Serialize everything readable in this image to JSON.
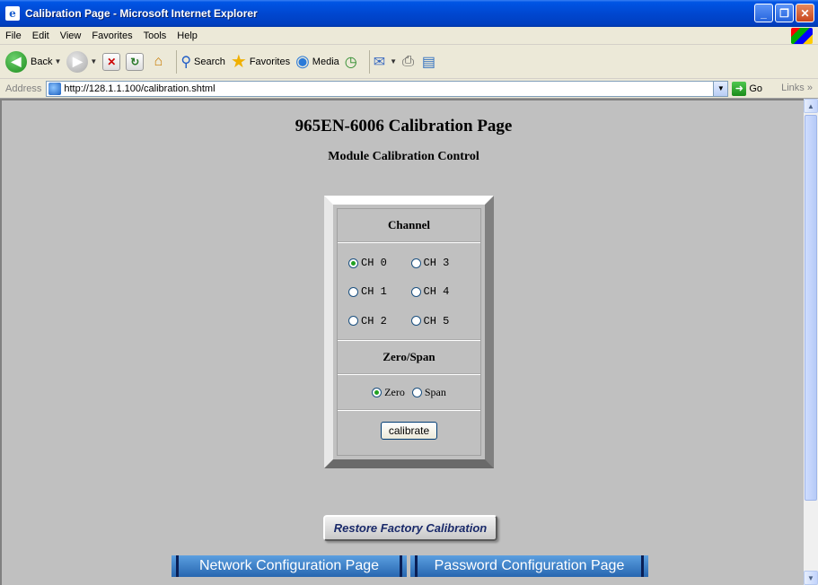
{
  "window": {
    "title": "Calibration Page - Microsoft Internet Explorer"
  },
  "menu": [
    "File",
    "Edit",
    "View",
    "Favorites",
    "Tools",
    "Help"
  ],
  "toolbar": {
    "back": "Back",
    "search": "Search",
    "favorites": "Favorites",
    "media": "Media"
  },
  "address": {
    "label": "Address",
    "url": "http://128.1.1.100/calibration.shtml",
    "go": "Go",
    "links": "Links"
  },
  "page": {
    "title": "965EN-6006 Calibration Page",
    "subtitle": "Module Calibration Control",
    "channel_header": "Channel",
    "channels": [
      {
        "label": "CH 0",
        "checked": true
      },
      {
        "label": "CH 3",
        "checked": false
      },
      {
        "label": "CH 1",
        "checked": false
      },
      {
        "label": "CH 4",
        "checked": false
      },
      {
        "label": "CH 2",
        "checked": false
      },
      {
        "label": "CH 5",
        "checked": false
      }
    ],
    "zero_span_header": "Zero/Span",
    "zero_label": "Zero",
    "span_label": "Span",
    "zero_checked": true,
    "calibrate_button": "calibrate",
    "restore_button": "Restore Factory Calibration",
    "nav_network": "Network Configuration Page",
    "nav_password": "Password Configuration Page"
  },
  "icons": {
    "back": "back-arrow-icon",
    "forward": "forward-arrow-icon",
    "stop": "stop-icon",
    "refresh": "refresh-icon",
    "home": "home-icon",
    "search": "search-icon",
    "favorites": "star-icon",
    "media": "media-icon",
    "history": "history-icon",
    "mail": "mail-icon",
    "print": "print-icon",
    "edit": "edit-icon"
  },
  "colors": {
    "titlebar": "#0047d0",
    "page_background": "#c0c0c0",
    "nav_button": "#2766b0"
  }
}
